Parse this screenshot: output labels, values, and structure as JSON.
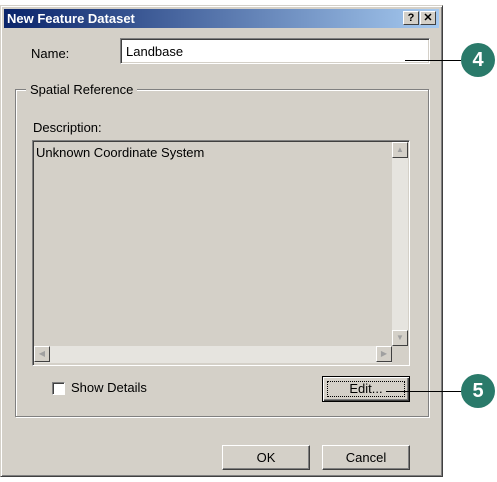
{
  "dialog": {
    "title": "New Feature Dataset",
    "help_button": "?",
    "close_button": "✕"
  },
  "name_field": {
    "label": "Name:",
    "value": "Landbase"
  },
  "spatial_reference": {
    "group_label": "Spatial Reference",
    "description_label": "Description:",
    "description_text": "Unknown Coordinate System",
    "show_details_label": "Show Details",
    "show_details_checked": false,
    "edit_button": "Edit..."
  },
  "footer": {
    "ok_button": "OK",
    "cancel_button": "Cancel"
  },
  "callouts": {
    "name_step": "4",
    "edit_step": "5",
    "color": "#2a7a6a"
  },
  "icons": {
    "scroll_up": "triangle-up",
    "scroll_down": "triangle-down",
    "scroll_left": "triangle-left",
    "scroll_right": "triangle-right"
  }
}
